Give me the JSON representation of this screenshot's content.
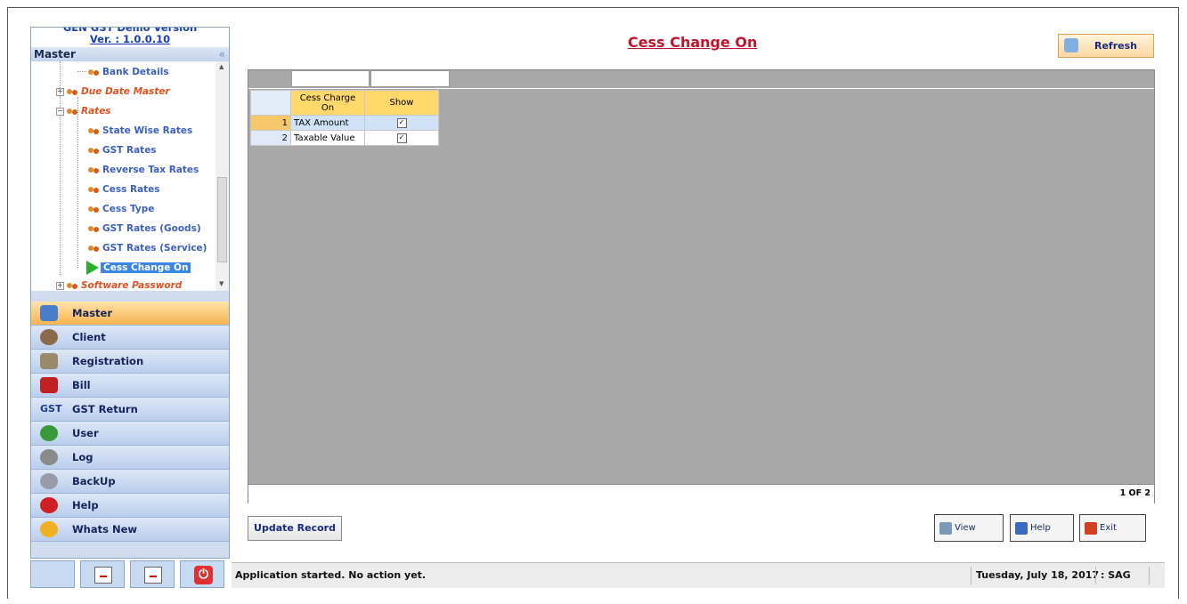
{
  "app": {
    "version_top": "GEN GST Demo Version",
    "version": "Ver. : 1.0.0.10"
  },
  "left_panel": {
    "header": "Master",
    "collapse_glyph": "«",
    "tree": [
      {
        "label": "Bank Details",
        "style": "item"
      },
      {
        "label": "Due Date Master",
        "style": "group"
      },
      {
        "label": "Rates",
        "style": "group"
      },
      {
        "label": "State Wise Rates",
        "style": "item"
      },
      {
        "label": "GST Rates",
        "style": "item"
      },
      {
        "label": "Reverse Tax Rates",
        "style": "item"
      },
      {
        "label": "Cess Rates",
        "style": "item"
      },
      {
        "label": "Cess Type",
        "style": "item"
      },
      {
        "label": "GST Rates (Goods)",
        "style": "item"
      },
      {
        "label": "GST Rates (Service)",
        "style": "item"
      },
      {
        "label": "Cess Change On",
        "style": "selected"
      },
      {
        "label": "Software Password",
        "style": "group"
      }
    ],
    "nav": [
      {
        "label": "Master",
        "icon": "master-icon",
        "color": "#4a7cc8",
        "active": true
      },
      {
        "label": "Client",
        "icon": "client-icon",
        "color": "#8a6a4a"
      },
      {
        "label": "Registration",
        "icon": "registration-icon",
        "color": "#9a8a6a"
      },
      {
        "label": "Bill",
        "icon": "bill-icon",
        "color": "#c02020"
      },
      {
        "label": "GST Return",
        "icon": "gst-icon",
        "color": "#1a3a8a"
      },
      {
        "label": "User",
        "icon": "users-icon",
        "color": "#3a9a3a"
      },
      {
        "label": "Log",
        "icon": "log-icon",
        "color": "#8a8a8a"
      },
      {
        "label": "BackUp",
        "icon": "backup-icon",
        "color": "#9a9aaa"
      },
      {
        "label": "Help",
        "icon": "help-icon",
        "color": "#d02020"
      },
      {
        "label": "Whats New",
        "icon": "new-icon",
        "color": "#f0b020"
      }
    ]
  },
  "main": {
    "title": "Cess Change On",
    "refresh_label": "Refresh",
    "grid": {
      "columns": [
        "Cess Charge On",
        "Show"
      ],
      "rows": [
        {
          "num": "1",
          "value": "TAX Amount",
          "show": "✓"
        },
        {
          "num": "2",
          "value": "Taxable Value",
          "show": "✓"
        }
      ],
      "page_indicator": "1 OF 2"
    },
    "update_label": "Update Record",
    "view_label": "View",
    "help_label": "Help",
    "exit_label": "Exit"
  },
  "status": {
    "message": "Application started. No action yet.",
    "date": "Tuesday, July 18, 2017",
    "user": ": SAG"
  }
}
